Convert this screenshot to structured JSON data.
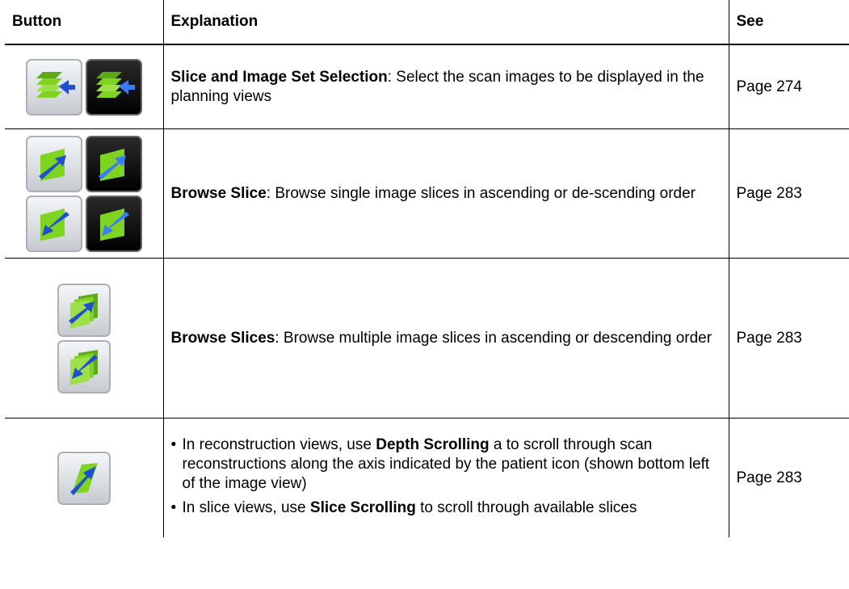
{
  "table": {
    "headers": {
      "button": "Button",
      "explanation": "Explanation",
      "see": "See"
    },
    "rows": [
      {
        "term": "Slice and Image Set Selection",
        "text": ": Select the scan images to be displayed in the planning views",
        "see": "Page 274",
        "icons": [
          "slice-set-selection-icon",
          "slice-set-selection-active-icon"
        ]
      },
      {
        "term": "Browse Slice",
        "text": ": Browse single image slices in ascending or de-scending order",
        "see": "Page 283",
        "icons": [
          "browse-slice-up-icon",
          "browse-slice-up-active-icon",
          "browse-slice-down-icon",
          "browse-slice-down-active-icon"
        ]
      },
      {
        "term": "Browse Slices",
        "text": ": Browse multiple image slices in ascending or descending order",
        "see": "Page 283",
        "icons": [
          "browse-slices-up-icon",
          "browse-slices-down-icon"
        ]
      },
      {
        "bullets": [
          {
            "pre": "In reconstruction views, use ",
            "term": "Depth Scrolling",
            "post": " a to scroll through scan reconstructions along the axis indicated by the patient icon (shown bottom left of the image view)"
          },
          {
            "pre": "In slice views, use ",
            "term": "Slice Scrolling",
            "post": " to scroll through available slices"
          }
        ],
        "see": "Page 283",
        "icons": [
          "depth-scrolling-icon"
        ]
      }
    ]
  },
  "colors": {
    "green": "#7fd321",
    "blue": "#1f4fd0",
    "rule": "#000000"
  }
}
